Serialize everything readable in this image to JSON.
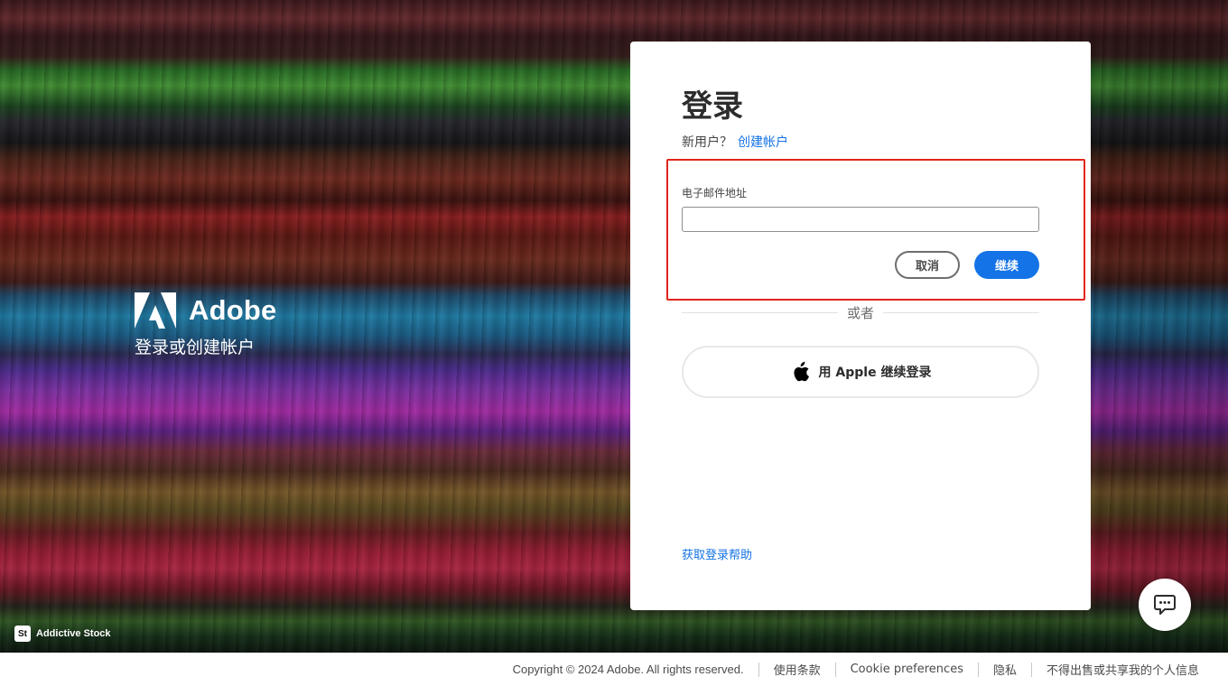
{
  "brand": {
    "name": "Adobe",
    "tagline": "登录或创建帐户",
    "stock_badge": "St",
    "stock_credit": "Addictive Stock"
  },
  "signin": {
    "title": "登录",
    "new_user_prompt": "新用户？",
    "create_account_link": "创建帐户",
    "email_label": "电子邮件地址",
    "email_value": "",
    "cancel_label": "取消",
    "continue_label": "继续",
    "divider_text": "或者",
    "apple_label": "用 Apple 继续登录",
    "help_link": "获取登录帮助"
  },
  "footer": {
    "copyright": "Copyright © 2024 Adobe. All rights reserved.",
    "terms": "使用条款",
    "cookies": "Cookie preferences",
    "privacy": "隐私",
    "do_not_sell": "不得出售或共享我的个人信息"
  },
  "colors": {
    "accent": "#1473e6",
    "highlight_border": "#e1241c"
  },
  "icons": {
    "brand_logo": "adobe-logo-icon",
    "apple": "apple-icon",
    "chat": "chat-icon"
  }
}
